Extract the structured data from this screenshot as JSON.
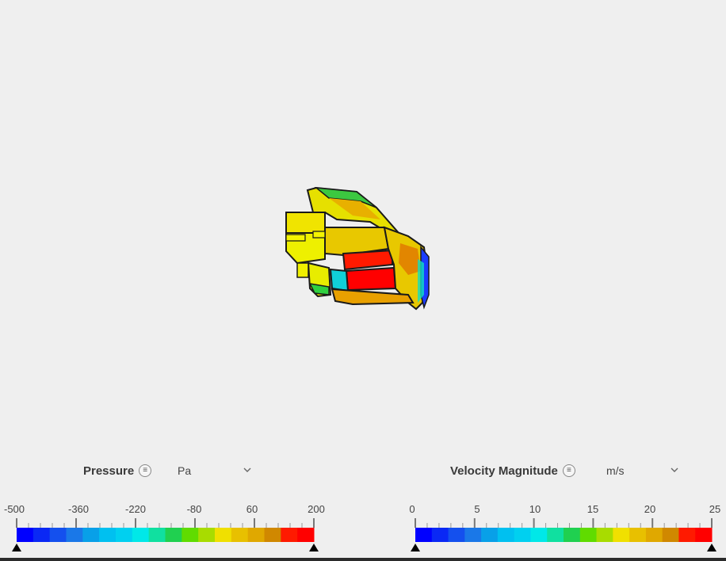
{
  "pressure_legend": {
    "title": "Pressure",
    "menu_icon": "menu-icon",
    "unit": "Pa",
    "ticks": [
      "-500",
      "-360",
      "-220",
      "-80",
      "60",
      "200"
    ],
    "colors": [
      "#0000ff",
      "#0a28f5",
      "#1450ee",
      "#1a78e8",
      "#08a0e8",
      "#00c0f0",
      "#00d0f0",
      "#00e8e8",
      "#10e0a0",
      "#20d050",
      "#60dc00",
      "#a8dc00",
      "#f0e000",
      "#e8c000",
      "#e0a800",
      "#d08800",
      "#ff1a00",
      "#ff0000"
    ]
  },
  "velocity_legend": {
    "title": "Velocity Magnitude",
    "menu_icon": "menu-icon",
    "unit": "m/s",
    "ticks": [
      "0",
      "5",
      "10",
      "15",
      "20",
      "25"
    ],
    "colors": [
      "#0000ff",
      "#0a28f5",
      "#1450ee",
      "#1a78e8",
      "#08a0e8",
      "#00c0f0",
      "#00d0f0",
      "#00e8e8",
      "#10e0a0",
      "#20d050",
      "#60dc00",
      "#a8dc00",
      "#f0e000",
      "#e8c000",
      "#e0a800",
      "#d08800",
      "#ff1a00",
      "#ff0000"
    ]
  },
  "icons": {
    "dropdown": "chevron-down-icon",
    "range_handle": "triangle-handle-icon"
  }
}
